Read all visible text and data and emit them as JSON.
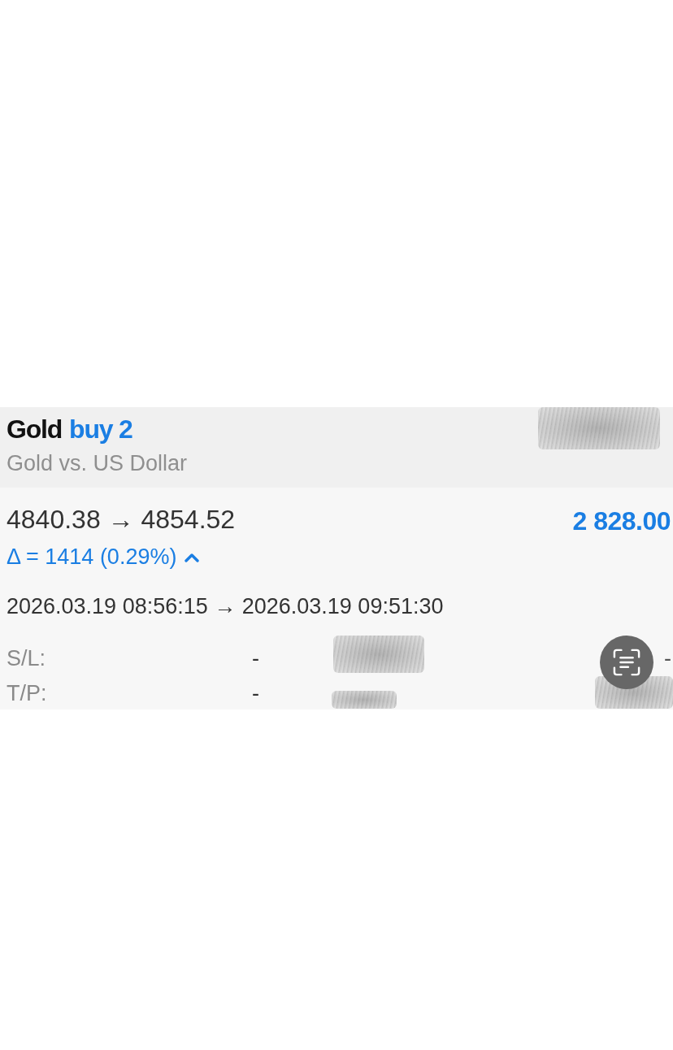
{
  "position": {
    "symbol": "Gold",
    "order": "buy 2",
    "description": "Gold vs. US Dollar"
  },
  "prices": {
    "open_close": "4840.38 → 4854.52",
    "profit": "2 828.00",
    "change": "Δ = 1414 (0.29%)",
    "rising": true
  },
  "times": "2026.03.19 08:56:15 → 2026.03.19 09:51:30",
  "fields": [
    {
      "label": "S/L:",
      "value": "-",
      "column_3": "-"
    },
    {
      "label": "T/P:",
      "value": "-"
    }
  ]
}
